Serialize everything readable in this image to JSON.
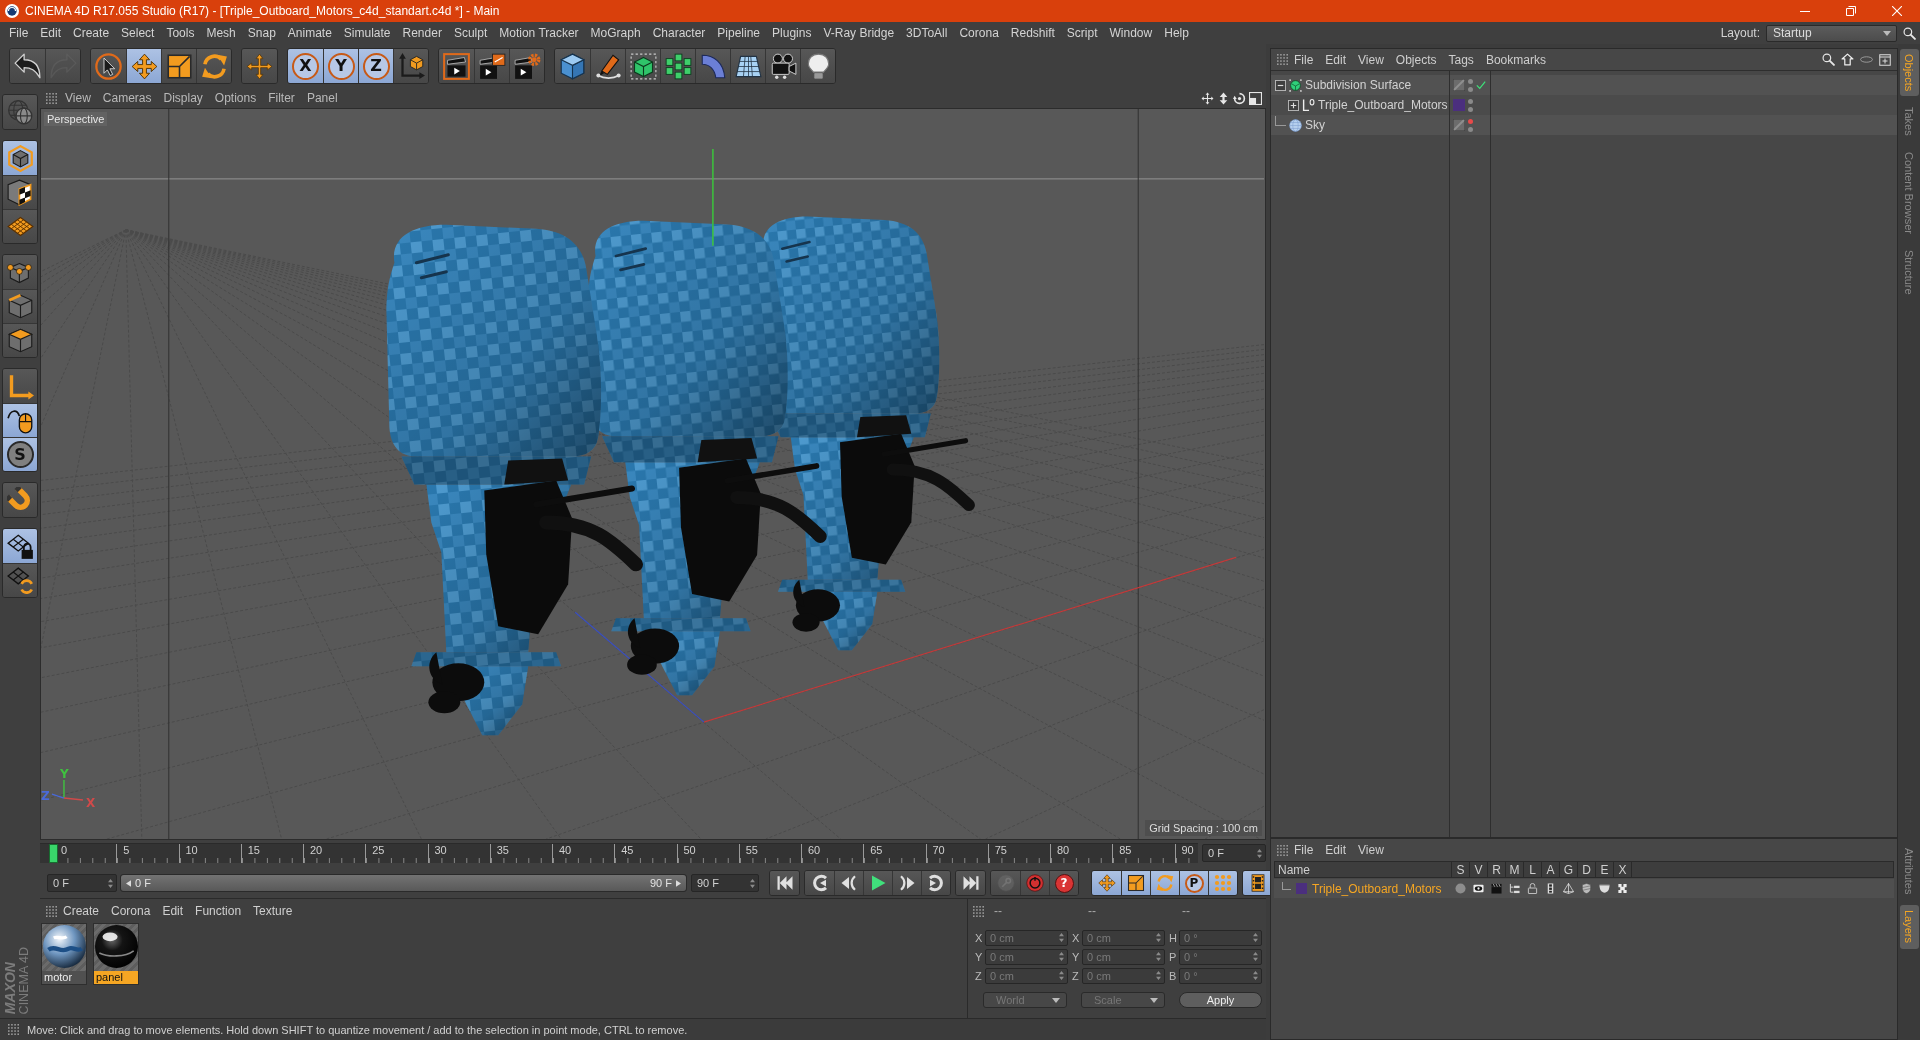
{
  "window": {
    "title": "CINEMA 4D R17.055 Studio (R17) - [Triple_Outboard_Motors_c4d_standart.c4d *] - Main"
  },
  "menu_bar": [
    "File",
    "Edit",
    "Create",
    "Select",
    "Tools",
    "Mesh",
    "Snap",
    "Animate",
    "Simulate",
    "Render",
    "Sculpt",
    "Motion Tracker",
    "MoGraph",
    "Character",
    "Pipeline",
    "Plugins",
    "V-Ray Bridge",
    "3DToAll",
    "Corona",
    "Redshift",
    "Script",
    "Window",
    "Help"
  ],
  "layout": {
    "label": "Layout:",
    "value": "Startup"
  },
  "toolbar": [
    [
      {
        "kind": "undo",
        "disabled": false
      },
      {
        "kind": "redo",
        "disabled": true
      }
    ],
    [
      {
        "kind": "live-select",
        "active": false
      },
      {
        "kind": "move",
        "active": true
      },
      {
        "kind": "scale",
        "active": false
      },
      {
        "kind": "rotate",
        "active": false
      }
    ],
    [
      {
        "kind": "transform",
        "active": false
      }
    ],
    [
      {
        "kind": "x-axis",
        "label": "X",
        "active": true
      },
      {
        "kind": "y-axis",
        "label": "Y",
        "active": true
      },
      {
        "kind": "z-axis",
        "label": "Z",
        "active": true
      },
      {
        "kind": "coordinate-system",
        "active": false
      }
    ],
    [
      {
        "kind": "render-view",
        "active": false
      },
      {
        "kind": "render-picture",
        "active": false
      },
      {
        "kind": "render-settings",
        "active": false
      }
    ],
    [
      {
        "kind": "cube",
        "active": false
      },
      {
        "kind": "pen",
        "active": false
      },
      {
        "kind": "subdivision",
        "active": false
      },
      {
        "kind": "cloner",
        "active": false
      },
      {
        "kind": "bend",
        "active": false
      },
      {
        "kind": "floor",
        "active": false
      },
      {
        "kind": "camera",
        "active": false
      },
      {
        "kind": "light",
        "active": false
      }
    ]
  ],
  "left_toolbar": [
    [
      {
        "kind": "make-editable",
        "active": false
      }
    ],
    [
      {
        "kind": "model-mode",
        "active": true
      },
      {
        "kind": "texture-mode",
        "active": false
      },
      {
        "kind": "workplane-mode",
        "active": false
      }
    ],
    [
      {
        "kind": "points-mode",
        "active": false
      },
      {
        "kind": "edges-mode",
        "active": false
      },
      {
        "kind": "polygons-mode",
        "active": false
      }
    ],
    [
      {
        "kind": "axis-mode",
        "active": false
      },
      {
        "kind": "tweak-mode",
        "active": true
      },
      {
        "kind": "solo",
        "label": "S",
        "active": true
      }
    ],
    [
      {
        "kind": "snap",
        "active": false
      }
    ],
    [
      {
        "kind": "workplane-lock",
        "active": true
      },
      {
        "kind": "workplane-rotate",
        "active": false
      }
    ]
  ],
  "logo": [
    "MAXON",
    "CINEMA 4D"
  ],
  "viewport": {
    "menu": [
      "View",
      "Cameras",
      "Display",
      "Options",
      "Filter",
      "Panel"
    ],
    "camera": "Perspective",
    "grid_spacing": "Grid Spacing : 100 cm",
    "axes": [
      {
        "label": "Y",
        "color": "#3fc23f"
      },
      {
        "label": "Z",
        "color": "#4a6ad8"
      },
      {
        "label": "X",
        "color": "#d04a4a"
      }
    ]
  },
  "timeline": {
    "ticks": [
      "0",
      "5",
      "10",
      "15",
      "20",
      "25",
      "30",
      "35",
      "40",
      "45",
      "50",
      "55",
      "60",
      "65",
      "70",
      "75",
      "80",
      "85",
      "90"
    ],
    "playhead": {
      "level": 0
    },
    "current_frame": "0 F",
    "start_field": "0 F",
    "range": {
      "start": "0 F",
      "end": "90 F",
      "level": 1
    },
    "end_field": "90 F",
    "transport": [
      [
        {
          "kind": "first"
        }
      ],
      [
        {
          "kind": "prev-key"
        },
        {
          "kind": "prev-frame"
        },
        {
          "kind": "play"
        },
        {
          "kind": "next-frame"
        },
        {
          "kind": "next-key"
        }
      ],
      [
        {
          "kind": "last"
        }
      ],
      [
        {
          "kind": "record",
          "disabled": true
        },
        {
          "kind": "autokey",
          "disabled": false
        },
        {
          "kind": "help",
          "label": "?",
          "disabled": false
        }
      ],
      [
        {
          "kind": "move",
          "active": true
        },
        {
          "kind": "scale",
          "active": true
        },
        {
          "kind": "rotate",
          "active": true
        },
        {
          "kind": "param",
          "label": "P",
          "active": true
        },
        {
          "kind": "points",
          "active": true
        }
      ],
      [
        {
          "kind": "film",
          "active": true
        }
      ]
    ]
  },
  "materials": {
    "menu": [
      "Create",
      "Corona",
      "Edit",
      "Function",
      "Texture"
    ],
    "items": [
      {
        "name": "motor",
        "kind": "textured",
        "selected": false
      },
      {
        "name": "panel",
        "kind": "glossy",
        "selected": true
      }
    ]
  },
  "coordinates": {
    "headers": [
      "--",
      "--",
      "--"
    ],
    "disabled": true,
    "rows": [
      [
        {
          "axis": "X",
          "value": "0 cm"
        },
        {
          "axis": "X",
          "value": "0 cm"
        },
        {
          "axis": "H",
          "value": "0 °"
        }
      ],
      [
        {
          "axis": "Y",
          "value": "0 cm"
        },
        {
          "axis": "Y",
          "value": "0 cm"
        },
        {
          "axis": "P",
          "value": "0 °"
        }
      ],
      [
        {
          "axis": "Z",
          "value": "0 cm"
        },
        {
          "axis": "Z",
          "value": "0 cm"
        },
        {
          "axis": "B",
          "value": "0 °"
        }
      ]
    ],
    "dropdowns": [
      "World",
      "Scale"
    ],
    "apply": "Apply"
  },
  "status_bar": "Move: Click and drag to move elements. Hold down SHIFT to quantize movement / add to the selection in point mode, CTRL to remove.",
  "objects": {
    "menu": [
      "File",
      "Edit",
      "View",
      "Objects",
      "Tags",
      "Bookmarks"
    ],
    "items": [
      {
        "name": "Subdivision Surface",
        "kind": "subdivision",
        "expanded": true,
        "enabled": true,
        "hidden_in_editor": false,
        "children": [
          {
            "name": "Triple_Outboard_Motors",
            "kind": "null",
            "expanded": false,
            "color": "#4b2f7e",
            "hidden_in_editor": false
          }
        ]
      },
      {
        "name": "Sky",
        "kind": "sky",
        "hidden_in_editor": true
      }
    ]
  },
  "layers": {
    "menu": [
      "File",
      "Edit",
      "View"
    ],
    "columns": [
      "Name",
      "S",
      "V",
      "R",
      "M",
      "L",
      "A",
      "G",
      "D",
      "E",
      "X"
    ],
    "rows": [
      {
        "name": "Triple_Outboard_Motors",
        "color": "#4b2f7e",
        "selected": true
      }
    ]
  },
  "side_tabs": {
    "upper": [
      {
        "label": "Objects",
        "selected": true
      },
      {
        "label": "Takes",
        "selected": false
      },
      {
        "label": "Content Browser",
        "selected": false
      },
      {
        "label": "Structure",
        "selected": false
      }
    ],
    "lower": [
      {
        "label": "Attributes",
        "selected": false
      },
      {
        "label": "Layers",
        "selected": true
      }
    ]
  }
}
